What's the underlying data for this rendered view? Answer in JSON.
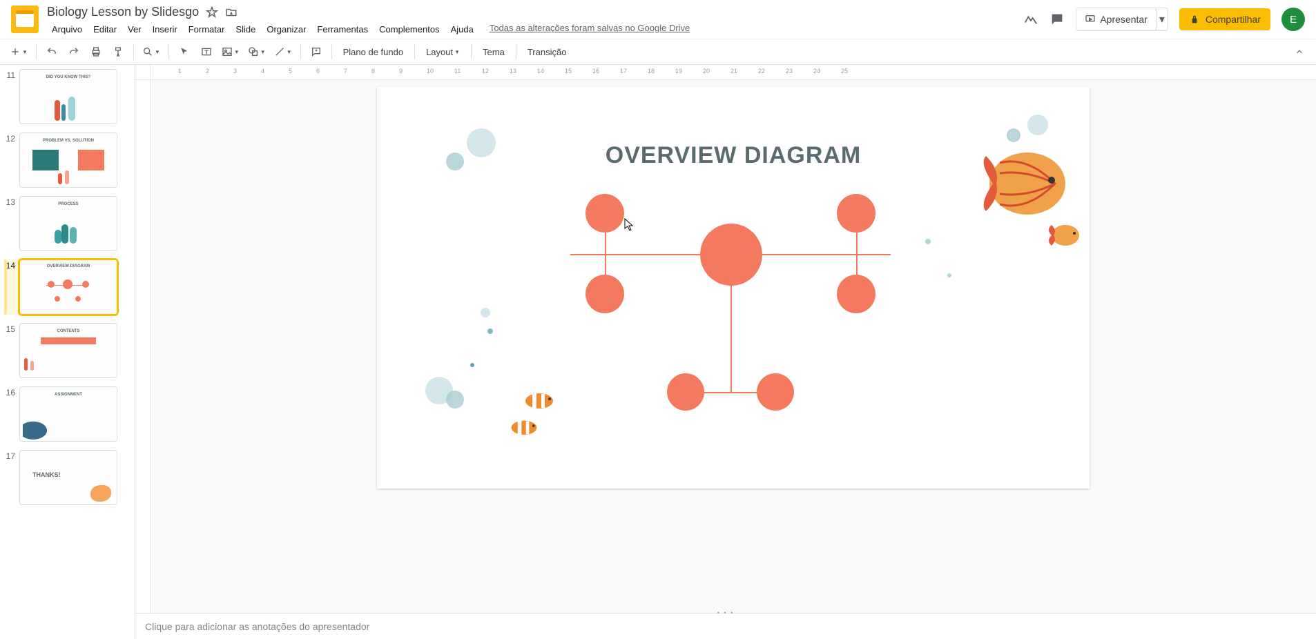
{
  "document": {
    "title": "Biology Lesson by Slidesgo",
    "save_status": "Todas as alterações foram salvas no Google Drive"
  },
  "menus": [
    "Arquivo",
    "Editar",
    "Ver",
    "Inserir",
    "Formatar",
    "Slide",
    "Organizar",
    "Ferramentas",
    "Complementos",
    "Ajuda"
  ],
  "header_actions": {
    "present": "Apresentar",
    "share": "Compartilhar",
    "avatar_letter": "E"
  },
  "toolbar": {
    "background": "Plano de fundo",
    "layout": "Layout",
    "theme": "Tema",
    "transition": "Transição"
  },
  "ruler_labels": [
    "1",
    "2",
    "3",
    "4",
    "5",
    "6",
    "7",
    "8",
    "9",
    "10",
    "11",
    "12",
    "13",
    "14",
    "15",
    "16",
    "17",
    "18",
    "19",
    "20",
    "21",
    "22",
    "23",
    "24",
    "25"
  ],
  "thumbnails": [
    {
      "num": 11,
      "caption": "DID YOU KNOW THIS?"
    },
    {
      "num": 12,
      "caption": "PROBLEM VS. SOLUTION"
    },
    {
      "num": 13,
      "caption": "PROCESS"
    },
    {
      "num": 14,
      "caption": "OVERVIEW DIAGRAM",
      "selected": true
    },
    {
      "num": 15,
      "caption": "CONTENTS"
    },
    {
      "num": 16,
      "caption": "ASSIGNMENT"
    },
    {
      "num": 17,
      "caption": "THANKS!"
    }
  ],
  "slide": {
    "title": "OVERVIEW DIAGRAM"
  },
  "notes": {
    "placeholder": "Clique para adicionar as anotações do apresentador"
  }
}
